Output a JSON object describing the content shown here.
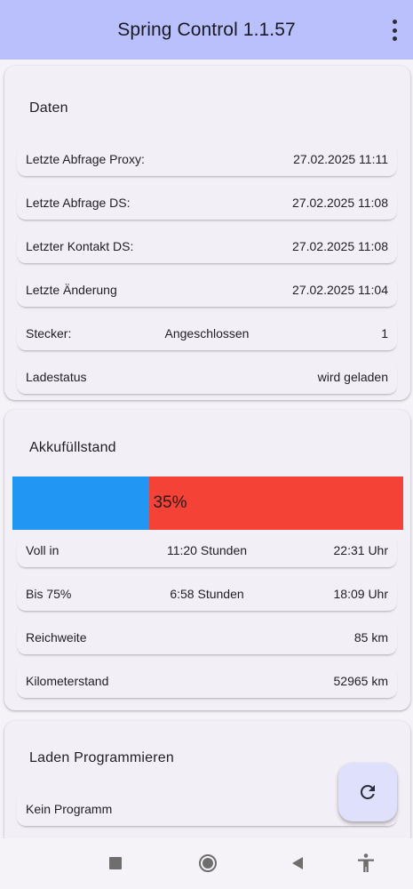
{
  "app": {
    "title": "Spring Control 1.1.57",
    "menu_icon": "more-vert-icon"
  },
  "daten": {
    "title": "Daten",
    "rows": [
      {
        "label": "Letzte Abfrage Proxy:",
        "value": "27.02.2025 11:11"
      },
      {
        "label": "Letzte Abfrage DS:",
        "value": "27.02.2025 11:08"
      },
      {
        "label": "Letzter Kontakt DS:",
        "value": "27.02.2025 11:08"
      },
      {
        "label": "Letzte Änderung",
        "value": "27.02.2025 11:04"
      }
    ],
    "stecker": {
      "label": "Stecker:",
      "status": "Angeschlossen",
      "value": "1"
    },
    "ladestatus": {
      "label": "Ladestatus",
      "value": "wird geladen"
    }
  },
  "akku": {
    "title": "Akkufüllstand",
    "level_percent": 35,
    "level_label": "35%",
    "fill_color": "#2196f3",
    "empty_color": "#f44336",
    "voll": {
      "label": "Voll in",
      "duration": "11:20 Stunden",
      "time": "22:31 Uhr"
    },
    "bis75": {
      "label": "Bis 75%",
      "duration": "6:58 Stunden",
      "time": "18:09 Uhr"
    },
    "reichweite": {
      "label": "Reichweite",
      "value": "85 km"
    },
    "kilometerstand": {
      "label": "Kilometerstand",
      "value": "52965 km"
    }
  },
  "laden": {
    "title": "Laden Programmieren",
    "program": {
      "label": "Kein Programm"
    }
  },
  "fab": {
    "icon": "refresh-icon"
  },
  "nav": {
    "icons": [
      "recents-icon",
      "home-icon",
      "back-icon",
      "accessibility-icon"
    ]
  },
  "colors": {
    "appbar": "#b9c0fc",
    "card": "#f3eff6",
    "fab": "#dfe0fb"
  }
}
